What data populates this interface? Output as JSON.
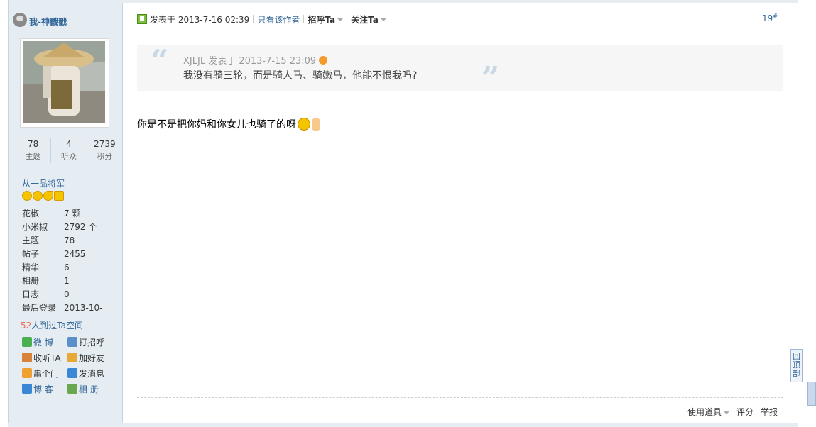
{
  "sidebar": {
    "username": "我-神戳戳",
    "stats": [
      {
        "value": "78",
        "label": "主题"
      },
      {
        "value": "4",
        "label": "听众"
      },
      {
        "value": "2739",
        "label": "积分"
      }
    ],
    "rank": "从一品将军",
    "info": [
      {
        "key": "花椒",
        "value": "7 颗"
      },
      {
        "key": "小米椒",
        "value": "2792 个"
      },
      {
        "key": "主题",
        "value": "78"
      },
      {
        "key": "帖子",
        "value": "2455"
      },
      {
        "key": "精华",
        "value": "6"
      },
      {
        "key": "相册",
        "value": "1"
      },
      {
        "key": "日志",
        "value": "0"
      },
      {
        "key": "最后登录",
        "value": "2013-10-"
      }
    ],
    "visit_count": "52",
    "visit_text": "人到过Ta空间",
    "actions": [
      {
        "label": "微 博",
        "color": "#4caf50"
      },
      {
        "label": "打招呼",
        "color": "#5b8fc9"
      },
      {
        "label": "收听TA",
        "color": "#d9823b"
      },
      {
        "label": "加好友",
        "color": "#e8a838"
      },
      {
        "label": "串个门",
        "color": "#f0a030"
      },
      {
        "label": "发消息",
        "color": "#3a87d6"
      },
      {
        "label": "博 客",
        "color": "#3a87d6"
      },
      {
        "label": "相 册",
        "color": "#6aa84f"
      }
    ]
  },
  "post": {
    "posted_at": "发表于 2013-7-16 02:39",
    "only_author": "只看该作者",
    "greet": "招呼Ta",
    "follow": "关注Ta",
    "floor": "19",
    "floor_mark": "#",
    "quote_author": "XJLJL 发表于 2013-7-15 23:09",
    "quote_text": "我没有骑三轮，而是骑人马、骑嫩马，他能不恨我吗?",
    "content": "你是不是把你妈和你女儿也骑了的呀",
    "footer": {
      "tools": "使用道具",
      "rate": "评分",
      "report": "举报"
    }
  },
  "scroll_top": "回\n顶\n部"
}
